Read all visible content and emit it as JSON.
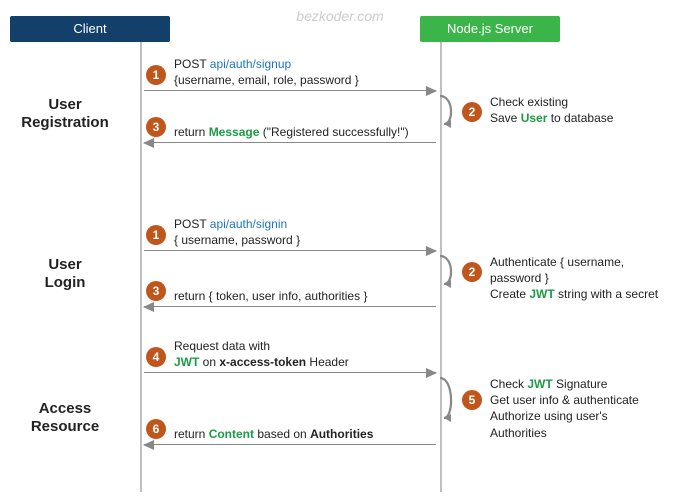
{
  "watermark": "bezkoder.com",
  "participants": {
    "client": "Client",
    "server": "Node.js Server"
  },
  "sections": {
    "registration": {
      "l1": "User",
      "l2": "Registration"
    },
    "login": {
      "l1": "User",
      "l2": "Login"
    },
    "access": {
      "l1": "Access",
      "l2": "Resource"
    }
  },
  "steps": {
    "reg_req": {
      "num": "1",
      "line1_prefix": "POST ",
      "line1_path": "api/auth/signup",
      "line2": "{username, email, role, password }"
    },
    "reg_srv": {
      "num": "2",
      "line1": "Check existing",
      "line2_prefix": "Save ",
      "line2_em": "User",
      "line2_suffix": " to database"
    },
    "reg_res": {
      "num": "3",
      "prefix": "return ",
      "em": "Message",
      "suffix": " (\"Registered successfully!\")"
    },
    "login_req": {
      "num": "1",
      "line1_prefix": "POST ",
      "line1_path": "api/auth/signin",
      "line2": "{ username, password }"
    },
    "login_srv": {
      "num": "2",
      "line1": "Authenticate { username, password }",
      "line2_prefix": "Create ",
      "line2_em": "JWT",
      "line2_suffix": " string with a secret"
    },
    "login_res": {
      "num": "3",
      "text": "return { token, user info, authorities }"
    },
    "acc_req": {
      "num": "4",
      "line1": "Request  data with",
      "line2_em": "JWT",
      "line2_mid": " on ",
      "line2_bold": "x-access-token",
      "line2_suffix": " Header"
    },
    "acc_srv": {
      "num": "5",
      "line1_prefix": "Check ",
      "line1_em": "JWT",
      "line1_suffix": " Signature",
      "line2": "Get user info & authenticate",
      "line3": "Authorize using user's Authorities"
    },
    "acc_res": {
      "num": "6",
      "prefix": "return ",
      "em": "Content",
      "mid": " based on ",
      "bold": "Authorities"
    }
  }
}
